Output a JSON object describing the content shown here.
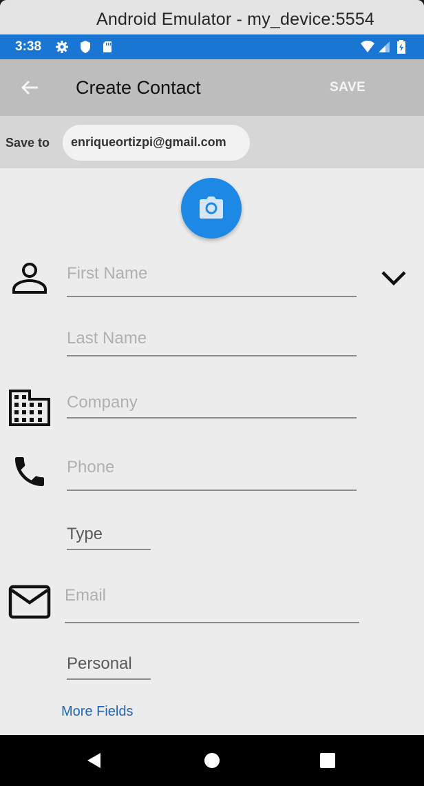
{
  "window": {
    "title": "Android Emulator - my_device:5554"
  },
  "status_bar": {
    "time": "3:38",
    "icons": [
      "gear-icon",
      "shield-icon",
      "sd-card-icon",
      "wifi-icon",
      "signal-icon",
      "battery-icon"
    ],
    "color": "#1976d2"
  },
  "app_bar": {
    "title": "Create Contact",
    "save_label": "SAVE"
  },
  "save_to": {
    "label": "Save to",
    "account": "enriqueortizpi@gmail.com"
  },
  "form": {
    "first_name_placeholder": "First Name",
    "last_name_placeholder": "Last Name",
    "company_placeholder": "Company",
    "phone_placeholder": "Phone",
    "phone_type": "Type",
    "email_placeholder": "Email",
    "email_type": "Personal",
    "more_fields": "More Fields"
  },
  "colors": {
    "accent": "#1e88e5",
    "link": "#1e66b5"
  }
}
